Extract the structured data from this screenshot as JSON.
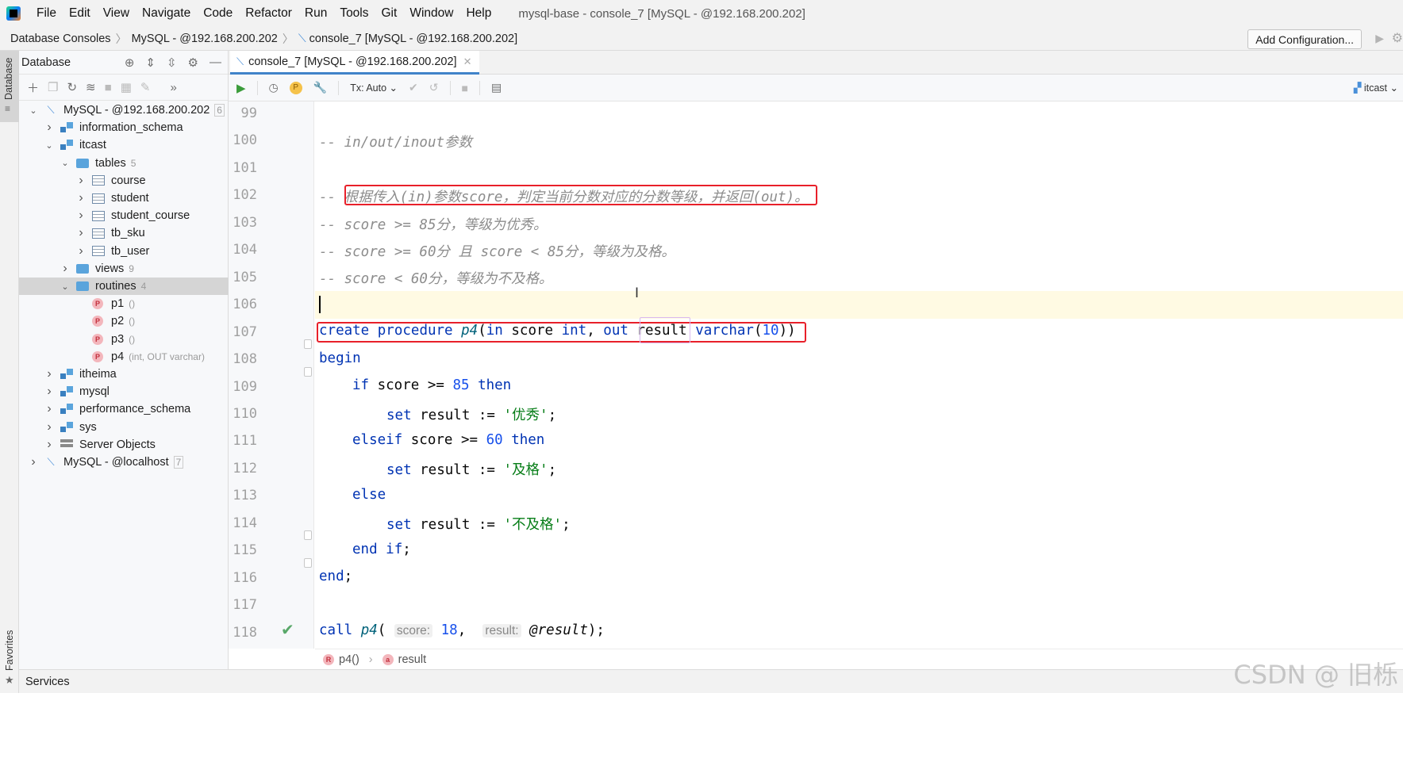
{
  "menubar": {
    "items": [
      "File",
      "Edit",
      "View",
      "Navigate",
      "Code",
      "Refactor",
      "Run",
      "Tools",
      "Git",
      "Window",
      "Help"
    ],
    "window_title": "mysql-base - console_7 [MySQL - @192.168.200.202]"
  },
  "navbar": {
    "crumbs": [
      "Database Consoles",
      "MySQL - @192.168.200.202",
      "console_7 [MySQL - @192.168.200.202]"
    ],
    "add_config": "Add Configuration..."
  },
  "left_stripe": {
    "database_label": "Database",
    "favorites_label": "Favorites"
  },
  "db_panel": {
    "title": "Database",
    "tree": [
      {
        "label": "MySQL - @192.168.200.202",
        "count": "6",
        "icon": "connection-icon",
        "level": 0,
        "expanded": true
      },
      {
        "label": "information_schema",
        "icon": "schema-icon",
        "level": 1,
        "expanded": false
      },
      {
        "label": "itcast",
        "icon": "schema-icon",
        "level": 1,
        "expanded": true
      },
      {
        "label": "tables",
        "count": "5",
        "icon": "folder-icon",
        "level": 2,
        "expanded": true
      },
      {
        "label": "course",
        "icon": "table-icon",
        "level": 3,
        "expanded": false
      },
      {
        "label": "student",
        "icon": "table-icon",
        "level": 3,
        "expanded": false
      },
      {
        "label": "student_course",
        "icon": "table-icon",
        "level": 3,
        "expanded": false
      },
      {
        "label": "tb_sku",
        "icon": "table-icon",
        "level": 3,
        "expanded": false
      },
      {
        "label": "tb_user",
        "icon": "table-icon",
        "level": 3,
        "expanded": false
      },
      {
        "label": "views",
        "count": "9",
        "icon": "folder-icon",
        "level": 2,
        "expanded": false
      },
      {
        "label": "routines",
        "count": "4",
        "icon": "folder-icon",
        "level": 2,
        "expanded": true,
        "selected": true
      },
      {
        "label": "p1",
        "count": "()",
        "icon": "procedure-icon",
        "level": 3
      },
      {
        "label": "p2",
        "count": "()",
        "icon": "procedure-icon",
        "level": 3
      },
      {
        "label": "p3",
        "count": "()",
        "icon": "procedure-icon",
        "level": 3
      },
      {
        "label": "p4",
        "count": "(int, OUT varchar)",
        "icon": "procedure-icon",
        "level": 3
      },
      {
        "label": "itheima",
        "icon": "schema-icon",
        "level": 1,
        "expanded": false
      },
      {
        "label": "mysql",
        "icon": "schema-icon",
        "level": 1,
        "expanded": false
      },
      {
        "label": "performance_schema",
        "icon": "schema-icon",
        "level": 1,
        "expanded": false
      },
      {
        "label": "sys",
        "icon": "schema-icon",
        "level": 1,
        "expanded": false
      },
      {
        "label": "Server Objects",
        "icon": "server-icon",
        "level": 1,
        "expanded": false
      },
      {
        "label": "MySQL - @localhost",
        "count": "7",
        "icon": "connection-icon",
        "level": 0,
        "expanded": false
      }
    ]
  },
  "editor": {
    "tab_label": "console_7 [MySQL - @192.168.200.202]",
    "tx_label": "Tx: Auto",
    "schema_label": "itcast",
    "line_numbers": [
      "99",
      "100",
      "101",
      "102",
      "103",
      "104",
      "105",
      "106",
      "107",
      "108",
      "109",
      "110",
      "111",
      "112",
      "113",
      "114",
      "115",
      "116",
      "117",
      "118"
    ],
    "lines": {
      "l100": "-- in/out/inout参数",
      "l102_prefix": "-- ",
      "l102_comment": "根据传入(in)参数score，判定当前分数对应的分数等级，并返回(out)。",
      "l103": "-- score >= 85分，等级为优秀。",
      "l104": "-- score >= 60分 且 score < 85分，等级为及格。",
      "l105": "-- score < 60分，等级为不及格。",
      "l107": {
        "create": "create",
        "procedure": "procedure",
        "name": "p4",
        "open": "(",
        "in": "in",
        "p1": " score ",
        "int": "int",
        "comma": ", ",
        "out": "out",
        "p2": " result ",
        "varchar": "varchar",
        "lp": "(",
        "n10": "10",
        "close": "))"
      },
      "l108": "begin",
      "l109": {
        "if": "if",
        "mid": " score >= ",
        "n": "85",
        "then": "then"
      },
      "l110": {
        "set": "set",
        "mid": " result := ",
        "str": "'优秀'",
        "end": ";"
      },
      "l111": {
        "elseif": "elseif",
        "mid": " score >= ",
        "n": "60",
        "then": "then"
      },
      "l112": {
        "set": "set",
        "mid": " result := ",
        "str": "'及格'",
        "end": ";"
      },
      "l113": "else",
      "l114": {
        "set": "set",
        "mid": " result := ",
        "str": "'不及格'",
        "end": ";"
      },
      "l115": {
        "end": "end",
        "if": "if",
        "semi": ";"
      },
      "l116": {
        "end": "end",
        "semi": ";"
      },
      "l118": {
        "call": "call",
        "name": "p4",
        "open": "(",
        "hint1": "score:",
        "n": "18",
        "comma": ", ",
        "hint2": "result:",
        "var": "@result",
        "close": ");"
      }
    }
  },
  "breadcrumb_bottom": {
    "item1": "p4()",
    "item2": "result"
  },
  "statusbar": {
    "services": "Services"
  },
  "watermark": "CSDN @ 旧栎",
  "colors": {
    "keyword": "#0033b3",
    "number": "#1750eb",
    "string": "#067d17",
    "comment": "#8c8c8c",
    "highlight": "#e8202a",
    "accent": "#4083c9"
  }
}
